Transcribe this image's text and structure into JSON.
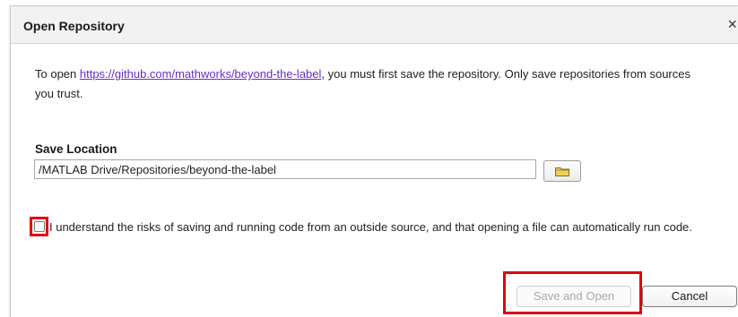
{
  "dialog": {
    "title": "Open Repository",
    "close_icon": "×"
  },
  "message": {
    "prefix": "To open ",
    "link": "https://github.com/mathworks/beyond-the-label",
    "suffix": ", you must first save the repository. Only save repositories from sources you trust."
  },
  "save_location": {
    "label": "Save Location",
    "value": "/MATLAB Drive/Repositories/beyond-the-label",
    "browse_icon": "folder-icon"
  },
  "risk_checkbox": {
    "checked": false,
    "label": "I understand the risks of saving and running code from an outside source, and that opening a file can automatically run code."
  },
  "buttons": {
    "save_and_open": "Save and Open",
    "save_and_open_enabled": false,
    "cancel": "Cancel"
  },
  "colors": {
    "highlight": "#e3000f",
    "link": "#6a2bc9",
    "folder": "#f2cf5b"
  }
}
